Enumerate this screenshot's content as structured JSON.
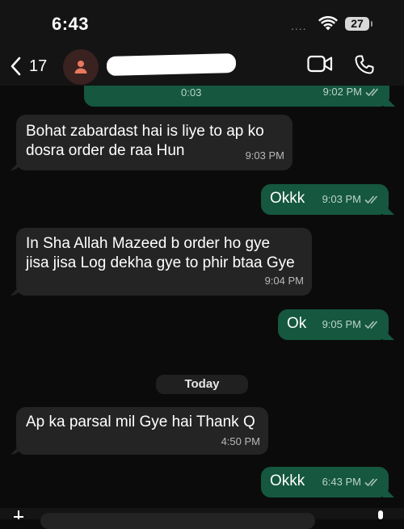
{
  "status_bar": {
    "time": "6:43",
    "signal": "....",
    "battery_level": "27"
  },
  "header": {
    "back_count": "17"
  },
  "messages": [
    {
      "direction": "out",
      "type": "voice",
      "duration": "0:03",
      "time": "9:02 PM",
      "status": "read"
    },
    {
      "direction": "in",
      "text": "Bohat zabardast hai   is liye to ap ko\ndosra order de raa Hun",
      "time": "9:03 PM"
    },
    {
      "direction": "out",
      "text": "Okkk",
      "time": "9:03 PM",
      "status": "read"
    },
    {
      "direction": "in",
      "text": "In Sha Allah Mazeed b order ho gye\njisa jisa Log dekha gye to phir btaa Gye",
      "time": "9:04 PM"
    },
    {
      "direction": "out",
      "text": "Ok",
      "time": "9:05 PM",
      "status": "read"
    },
    {
      "direction": "in",
      "text": "Ap ka parsal mil Gye hai Thank Q",
      "time": "4:50 PM"
    },
    {
      "direction": "out",
      "text": "Okkk",
      "time": "6:43 PM",
      "status": "read"
    }
  ],
  "date_separator": "Today",
  "colors": {
    "background": "#0b0b0b",
    "incoming_bubble": "#242424",
    "outgoing_bubble": "#15573f",
    "avatar_icon": "#e8795f"
  },
  "icons": [
    "wifi-icon",
    "back-chevron-icon",
    "person-icon",
    "video-call-icon",
    "phone-icon",
    "double-check-icon"
  ]
}
